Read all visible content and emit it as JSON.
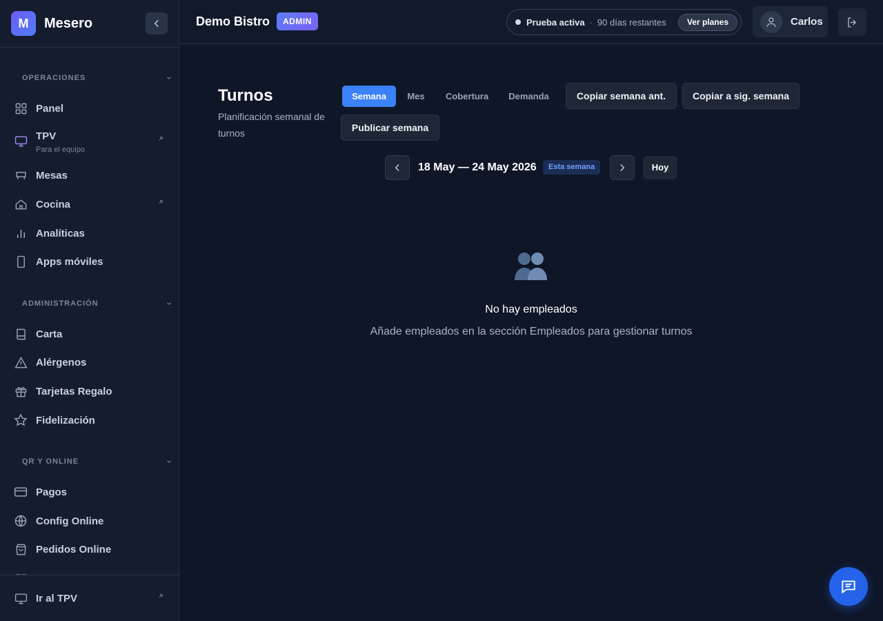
{
  "brand": {
    "logo_letter": "M",
    "name": "Mesero"
  },
  "sidebar": {
    "sections": [
      {
        "title": "OPERACIONES"
      },
      {
        "title": "ADMINISTRACIÓN"
      },
      {
        "title": "QR Y ONLINE"
      }
    ],
    "items": [
      {
        "label": "Panel",
        "icon": "grid-icon"
      },
      {
        "label": "TPV",
        "sublabel": "Para el equipo",
        "icon": "monitor-icon",
        "external": true
      },
      {
        "label": "Mesas",
        "icon": "table-icon"
      },
      {
        "label": "Cocina",
        "icon": "home-icon",
        "external": true
      },
      {
        "label": "Analíticas",
        "icon": "bar-chart-icon"
      },
      {
        "label": "Apps móviles",
        "icon": "phone-icon"
      },
      {
        "label": "Carta",
        "icon": "book-icon"
      },
      {
        "label": "Alérgenos",
        "icon": "warning-icon"
      },
      {
        "label": "Tarjetas Regalo",
        "icon": "gift-icon"
      },
      {
        "label": "Fidelización",
        "icon": "star-icon"
      },
      {
        "label": "Pagos",
        "icon": "credit-card-icon"
      },
      {
        "label": "Config Online",
        "icon": "globe-icon"
      },
      {
        "label": "Pedidos Online",
        "icon": "shopping-bag-icon"
      }
    ],
    "footer": {
      "label": "Ir al TPV",
      "icon": "monitor-icon"
    }
  },
  "topbar": {
    "business_name": "Demo Bistro",
    "role_badge": "ADMIN",
    "trial": {
      "label": "Prueba activa",
      "separator": "·",
      "days": "90 días restantes",
      "button": "Ver planes"
    },
    "user": {
      "name": "Carlos"
    }
  },
  "page": {
    "title": "Turnos",
    "subtitle": "Planificación semanal de turnos",
    "tabs": [
      {
        "label": "Semana",
        "active": true
      },
      {
        "label": "Mes",
        "active": false
      },
      {
        "label": "Cobertura",
        "active": false
      },
      {
        "label": "Demanda",
        "active": false
      }
    ],
    "actions": {
      "copy_prev": "Copiar semana ant.",
      "copy_next": "Copiar a sig. semana",
      "publish": "Publicar semana"
    },
    "week": {
      "range": "18 May — 24 May 2026",
      "badge": "Esta semana",
      "today": "Hoy"
    },
    "empty": {
      "icon": "people-icon",
      "title": "No hay empleados",
      "text": "Añade empleados en la sección Empleados para gestionar turnos"
    }
  },
  "colors": {
    "background": "#0f1628",
    "sidebar": "#141c2e",
    "accent": "#3b82f6",
    "brand_gradient_start": "#6d5cf6",
    "brand_gradient_end": "#4f7df5",
    "tpv_icon": "#a78bfa"
  }
}
